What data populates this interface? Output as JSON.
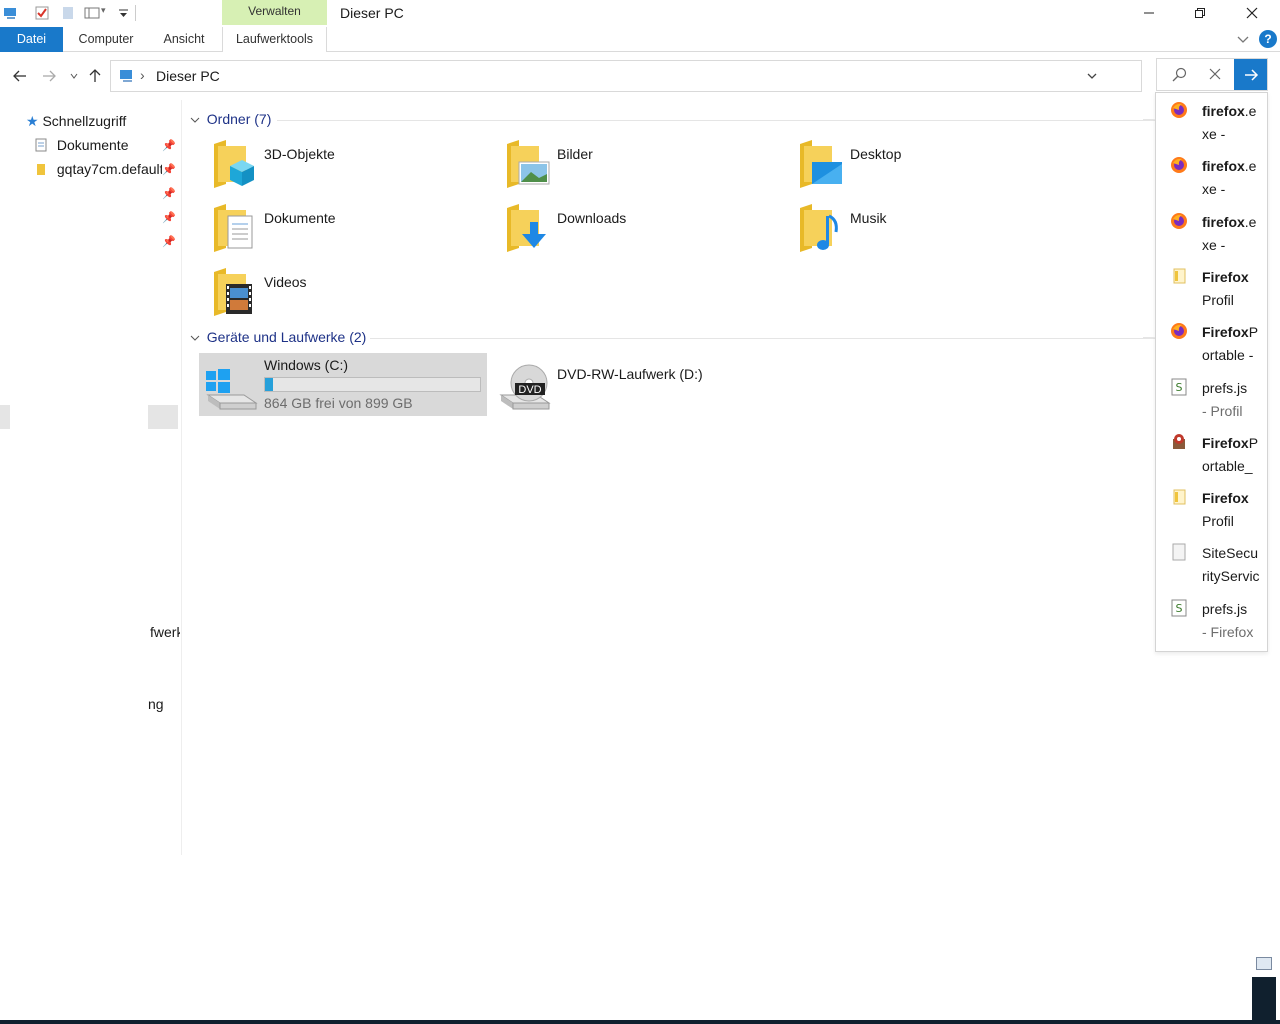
{
  "window": {
    "title": "Dieser PC",
    "context_tab_header": "Verwalten"
  },
  "ribbon": {
    "tabs": [
      {
        "label": "Datei"
      },
      {
        "label": "Computer"
      },
      {
        "label": "Ansicht"
      },
      {
        "label": "Laufwerktools"
      }
    ]
  },
  "address": {
    "separator": "›",
    "path": "Dieser PC"
  },
  "nav_pane": {
    "quick_access": "Schnellzugriff",
    "items": [
      {
        "label": "Dokumente"
      },
      {
        "label": "gqtay7cm.default"
      }
    ],
    "fragments": [
      "fwerk",
      "ng"
    ]
  },
  "content": {
    "folders_header": "Ordner (7)",
    "folders": [
      {
        "label": "3D-Objekte"
      },
      {
        "label": "Bilder"
      },
      {
        "label": "Desktop"
      },
      {
        "label": "Dokumente"
      },
      {
        "label": "Downloads"
      },
      {
        "label": "Musik"
      },
      {
        "label": "Videos"
      }
    ],
    "devices_header": "Geräte und Laufwerke (2)",
    "drives": [
      {
        "label": "Windows (C:)",
        "free_text": "864 GB frei von 899 GB",
        "used_fraction": 0.039
      },
      {
        "label": "DVD-RW-Laufwerk (D:)",
        "badge": "DVD"
      }
    ]
  },
  "search_results": [
    {
      "bold": "firefox",
      "rest": ".e",
      "line2": "xe  -",
      "icon": "firefox-icon"
    },
    {
      "bold": "firefox",
      "rest": ".e",
      "line2": "xe  -",
      "icon": "firefox-icon"
    },
    {
      "bold": "firefox",
      "rest": ".e",
      "line2": "xe -",
      "icon": "firefox-icon"
    },
    {
      "bold": "Firefox",
      "rest": "",
      "line2": "Profil",
      "icon": "folder-icon"
    },
    {
      "bold": "Firefox",
      "rest": "P",
      "line2": "ortable -",
      "icon": "firefox-icon"
    },
    {
      "bold": "",
      "rest": "prefs.js",
      "line2": "- Profil",
      "icon": "js-file-icon"
    },
    {
      "bold": "Firefox",
      "rest": "P",
      "line2": "ortable_",
      "icon": "installer-icon"
    },
    {
      "bold": "Firefox",
      "rest": "",
      "line2": "Profil",
      "icon": "folder-icon"
    },
    {
      "bold": "",
      "rest": "SiteSecu",
      "line2": "rityServic",
      "icon": "file-icon"
    },
    {
      "bold": "",
      "rest": "prefs.js",
      "line2": "- Firefox",
      "icon": "js-file-icon"
    }
  ],
  "colors": {
    "accent": "#1979ca",
    "context_tab": "#d7f0b4",
    "group_header": "#1e3287",
    "drive_bar": "#26a0da"
  }
}
